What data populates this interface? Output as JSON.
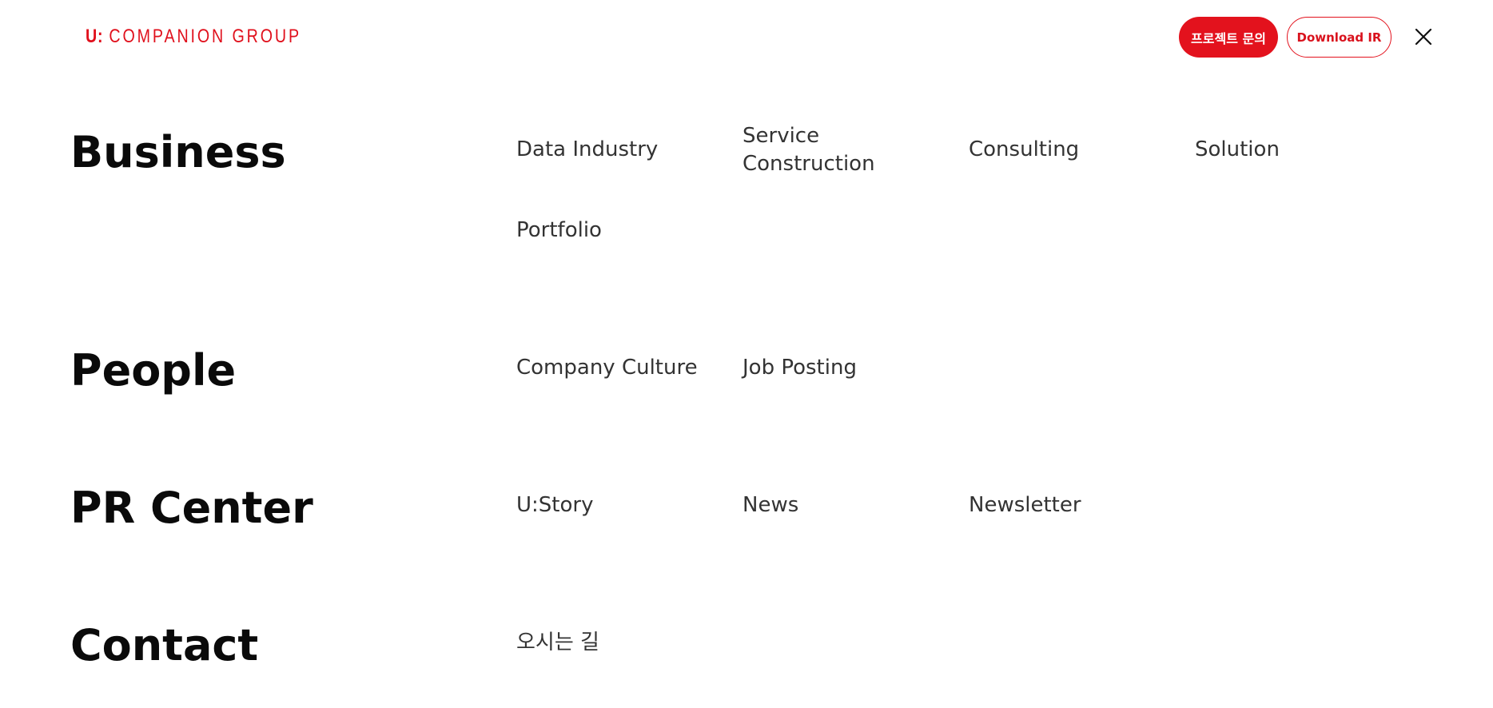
{
  "header": {
    "logo_mark": "U",
    "logo_sep": ":",
    "logo_text": "COMPANION GROUP",
    "inquiry_label": "프로젝트 문의",
    "download_label": "Download IR",
    "close_icon": "close-icon"
  },
  "colors": {
    "brand_red": "#e3121d",
    "text_dark": "#0a0a0a",
    "text_link": "#333333"
  },
  "menu": {
    "business": {
      "title": "Business",
      "items": [
        "Data Industry",
        "Service Construction",
        "Consulting",
        "Solution",
        "Portfolio"
      ]
    },
    "people": {
      "title": "People",
      "items": [
        "Company Culture",
        "Job Posting"
      ]
    },
    "pr_center": {
      "title": "PR Center",
      "items": [
        "U:Story",
        "News",
        "Newsletter"
      ]
    },
    "contact": {
      "title": "Contact",
      "items": [
        "오시는 길"
      ]
    }
  }
}
